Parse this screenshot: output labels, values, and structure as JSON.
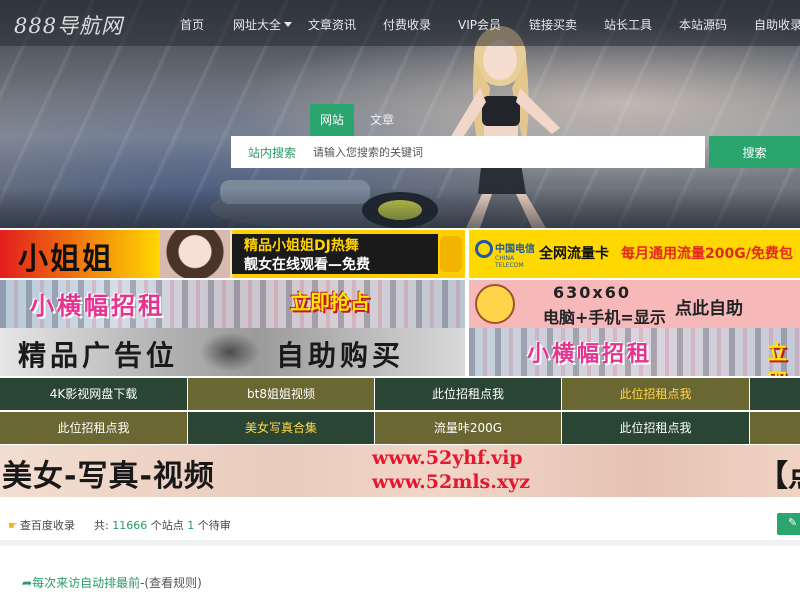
{
  "site": {
    "logo": "888导航网"
  },
  "nav": {
    "items": [
      {
        "label": "首页"
      },
      {
        "label": "网址大全"
      },
      {
        "label": "文章资讯"
      },
      {
        "label": "付费收录"
      },
      {
        "label": "VIP会员"
      },
      {
        "label": "链接买卖"
      },
      {
        "label": "站长工具"
      },
      {
        "label": "本站源码"
      },
      {
        "label": "自助收录"
      }
    ]
  },
  "search": {
    "tabs": [
      {
        "label": "网站",
        "active": true
      },
      {
        "label": "文章",
        "active": false
      }
    ],
    "label": "站内搜索",
    "placeholder": "请输入您搜索的关键词",
    "button": "搜索"
  },
  "ads": {
    "b1": {
      "big": "小姐姐",
      "line1": "精品小姐姐DJ热舞",
      "line2": "靓女在线观看—免费"
    },
    "b2": {
      "brand": "中国电信",
      "brand_en": "CHINA TELECOM",
      "text1": "全网流量卡",
      "text2": "每月通用流量200G/免费包"
    },
    "b3": {
      "big": "小横幅招租",
      "cta": "立即抢占"
    },
    "b4": {
      "line1": "630x60",
      "line2": "电脑+手机=显示",
      "cta": "点此自助"
    },
    "b5": {
      "left": "精品广告位",
      "right": "自助购买"
    },
    "b6": {
      "big": "小横幅招租",
      "cta": "立即"
    }
  },
  "link_grid": {
    "row1": [
      "4K影视网盘下载",
      "bt8姐姐视频",
      "此位招租点我",
      "此位招租点我"
    ],
    "row2": [
      "此位招租点我",
      "美女写真合集",
      "流量咔200G",
      "此位招租点我"
    ]
  },
  "big_banner": {
    "left": "美女-写真-视频",
    "url1": "www.52yhf.vip",
    "url2": "www.52mls.xyz",
    "right": "【点"
  },
  "stats": {
    "baidu": "查百度收录",
    "total_label": "共:",
    "total": "11666",
    "sites_label": "个站点",
    "pending": "1",
    "pending_label": "个待审"
  },
  "notice": {
    "text": "每次来访自动排最前",
    "link": "-(查看规则)"
  },
  "colors": {
    "accent": "#2aa56e",
    "cell_dark": "#2b4534",
    "cell_olive": "#6a6732"
  }
}
